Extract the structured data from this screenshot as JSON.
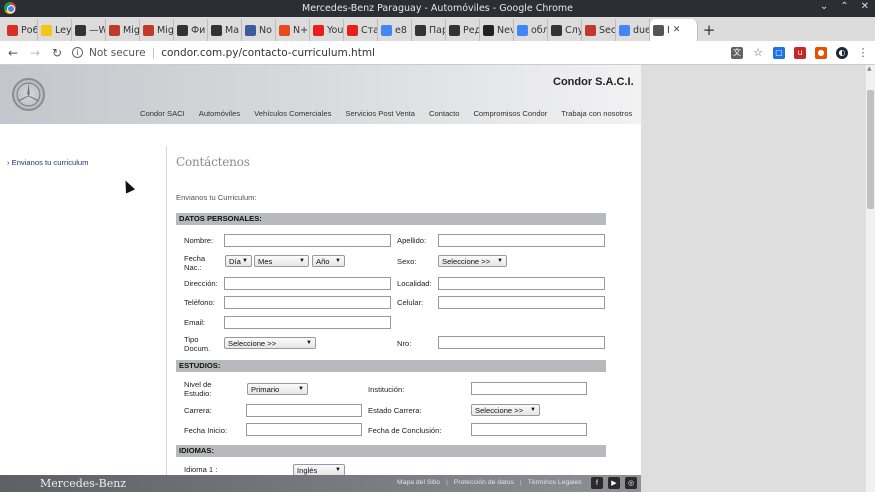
{
  "window": {
    "title": "Mercedes-Benz Paraguay - Automóviles - Google Chrome"
  },
  "tabs": [
    {
      "label": "Ро6",
      "icon": "star-icon",
      "color": "#d93025"
    },
    {
      "label": "Ley",
      "icon": "yellow-u-icon",
      "color": "#f5c518"
    },
    {
      "label": "—W",
      "icon": "wikipedia-icon",
      "color": "#333333"
    },
    {
      "label": "Mig",
      "icon": "migalki-icon",
      "color": "#c0392b"
    },
    {
      "label": "Mig",
      "icon": "migalki-icon",
      "color": "#c0392b"
    },
    {
      "label": "Фи",
      "icon": "wikipedia-icon",
      "color": "#333333"
    },
    {
      "label": "Ма",
      "icon": "wikipedia-icon",
      "color": "#333333"
    },
    {
      "label": "No",
      "icon": "globe-icon",
      "color": "#3b5b9b"
    },
    {
      "label": "N+",
      "icon": "n-plus-icon",
      "color": "#e8491d"
    },
    {
      "label": "You",
      "icon": "youtube-icon",
      "color": "#e62117"
    },
    {
      "label": "Ста",
      "icon": "youtube-icon",
      "color": "#e62117"
    },
    {
      "label": "е8",
      "icon": "google-icon",
      "color": "#4285f4"
    },
    {
      "label": "Пар",
      "icon": "plus-box-icon",
      "color": "#333333"
    },
    {
      "label": "Ред",
      "icon": "plus-box-icon",
      "color": "#333333"
    },
    {
      "label": "Nev",
      "icon": "m-icon",
      "color": "#222222"
    },
    {
      "label": "обл",
      "icon": "google-icon",
      "color": "#4285f4"
    },
    {
      "label": "Слу",
      "icon": "k-icon",
      "color": "#333333"
    },
    {
      "label": "Seс",
      "icon": "sec-icon",
      "color": "#c0392b"
    },
    {
      "label": "due",
      "icon": "google-icon",
      "color": "#4285f4"
    },
    {
      "label": "I",
      "icon": "globe-icon",
      "color": "#555555",
      "active": true
    }
  ],
  "toolbar": {
    "back": "←",
    "forward": "→",
    "reload": "↻",
    "security": "Not secure",
    "url": "condor.com.py/contacto-curriculum.html"
  },
  "site": {
    "company": "Condor S.A.C.I.",
    "nav": [
      "Condor SACI",
      "Automóviles",
      "Vehículos Comerciales",
      "Servicios Post Venta",
      "Contacto",
      "Compromisos Condor",
      "Trabaja con nosotros"
    ],
    "sidebar_link": "Envianos tu curriculum",
    "heading": "Contáctenos",
    "subheading": "Envianos tu Curriculum:"
  },
  "form": {
    "personal": {
      "title": "DATOS PERSONALES:",
      "nombre": "Nombre:",
      "apellido": "Apellido:",
      "fecha_nac": "Fecha Nac.:",
      "dia": "Día",
      "mes": "Mes",
      "anio": "Año",
      "sexo": "Sexo:",
      "sexo_value": "Seleccione >>",
      "direccion": "Dirección:",
      "localidad": "Localidad:",
      "telefono": "Teléfono:",
      "celular": "Celular:",
      "email": "Email:",
      "tipo_docum": "Tipo Docum.",
      "tipo_value": "Seleccione >>",
      "nro": "Nro:"
    },
    "studies": {
      "title": "ESTUDIOS:",
      "nivel": "Nivel de Estudio:",
      "nivel_value": "Primario",
      "institucion": "Institución:",
      "carrera": "Carrera:",
      "estado": "Estado Carrera:",
      "estado_value": "Seleccione >>",
      "fecha_inicio": "Fecha Inicio:",
      "fecha_conclusion": "Fecha de Conclusión:"
    },
    "languages": {
      "title": "IDIOMAS:",
      "idioma1": "Idioma 1 :",
      "idioma1_value": "Inglés"
    }
  },
  "footer": {
    "wordmark": "Mercedes-Benz",
    "links": [
      "Mapa del Sitio",
      "Protección de datos",
      "Términos Legales"
    ],
    "social": [
      {
        "icon": "facebook-icon",
        "glyph": "f"
      },
      {
        "icon": "youtube-icon",
        "glyph": "▶"
      },
      {
        "icon": "instagram-icon",
        "glyph": "◎"
      }
    ]
  }
}
